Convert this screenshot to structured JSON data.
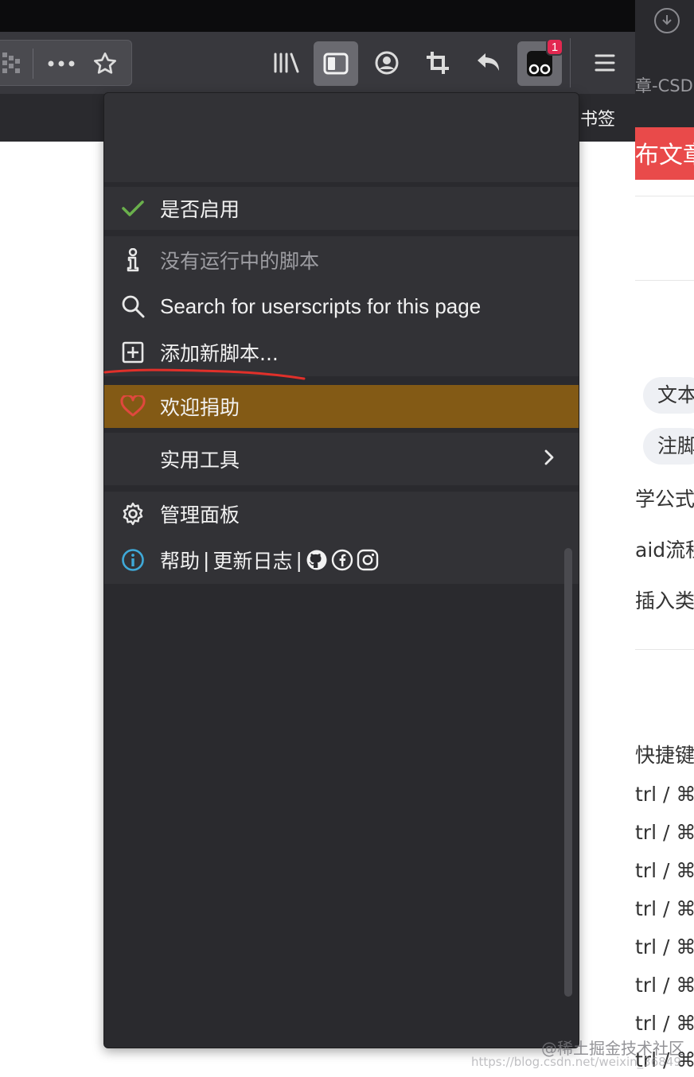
{
  "toolbar": {
    "extension_badge_count": "1"
  },
  "bookmarks_bar": {
    "visible_label": "书签"
  },
  "background_window": {
    "tab_text": "章-CSD",
    "publish_button_text": "布文章",
    "pills": [
      "文本",
      "注脚"
    ],
    "items": [
      "学公式",
      "aid流程",
      "插入类"
    ],
    "shortcuts_heading": "快捷键",
    "shortcut_rows": [
      "trl / ⌘",
      "trl / ⌘",
      "trl / ⌘",
      "trl / ⌘",
      "trl / ⌘",
      "trl / ⌘",
      "trl / ⌘",
      "trl / ⌘"
    ]
  },
  "panel": {
    "enabled_label": "是否启用",
    "no_scripts_label": "没有运行中的脚本",
    "search_label": "Search for userscripts for this page",
    "add_script_label": "添加新脚本...",
    "donate_label": "欢迎捐助",
    "utilities_label": "实用工具",
    "dashboard_label": "管理面板",
    "help_label": "帮助",
    "separator": "|",
    "changelog_label": "更新日志"
  },
  "colors": {
    "panel_bg": "#2a2a2e",
    "section_bg": "#323236",
    "donate_bg": "#835a15",
    "check_green": "#6ab04c",
    "heart_red": "#e0483e",
    "info_blue": "#3fa9d8",
    "underline_red": "#e0302a"
  },
  "watermark": {
    "text": "@稀土掘金技术社区",
    "url": "https://blog.csdn.net/weixin_36849"
  }
}
